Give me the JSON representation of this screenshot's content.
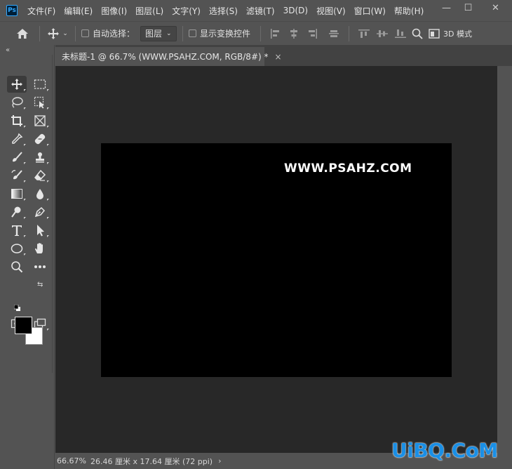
{
  "app": {
    "logo_text": "Ps"
  },
  "menu": [
    "文件(F)",
    "编辑(E)",
    "图像(I)",
    "图层(L)",
    "文字(Y)",
    "选择(S)",
    "滤镜(T)",
    "3D(D)",
    "视图(V)",
    "窗口(W)",
    "帮助(H)"
  ],
  "window_controls": {
    "minimize": "—",
    "maximize": "☐",
    "close": "✕"
  },
  "options": {
    "auto_select_label": "自动选择：",
    "auto_select_value": "图层",
    "show_transform_label": "显示变换控件",
    "mode_3d_label": "3D 模式"
  },
  "document": {
    "tab_title": "未标题-1 @ 66.7% (WWW.PSAHZ.COM, RGB/8#) *",
    "tab_close": "×",
    "canvas_text": "WWW.PSAHZ.COM"
  },
  "colors": {
    "foreground": "#000000",
    "background": "#ffffff",
    "canvas": "#000000",
    "workspace": "#282828"
  },
  "status": {
    "zoom": "66.67%",
    "size": "26.46 厘米 x 17.64 厘米 (72 ppi)",
    "arrow": "›"
  },
  "watermark": {
    "text": "UiBQ.CoM"
  }
}
